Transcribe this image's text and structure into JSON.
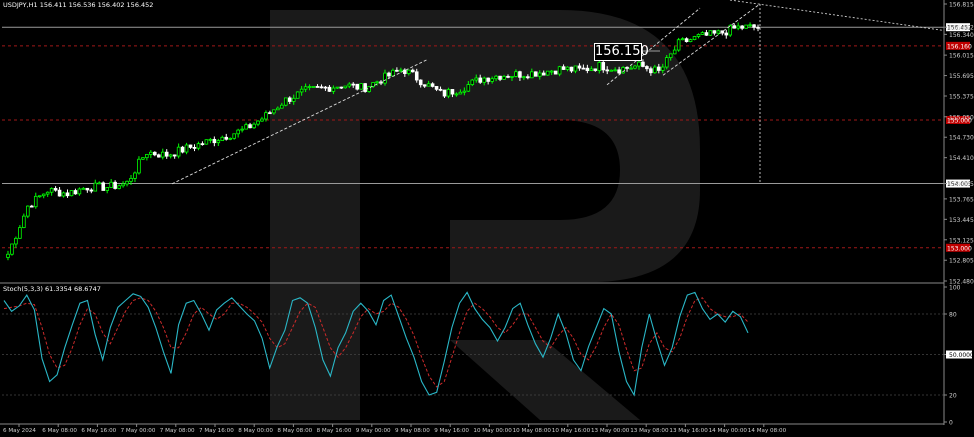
{
  "header": {
    "symbol_line": "USDJPY,H1  156.411 156.536 156.402 156.452",
    "stoch_line": "Stoch(5,3,3) 61.3354 68.6747"
  },
  "callout": {
    "value": "156.150"
  },
  "price_axis": {
    "ticks": [
      "156.815",
      "156.452",
      "156.340",
      "156.015",
      "155.695",
      "155.375",
      "155.050",
      "154.730",
      "154.410",
      "154.005",
      "153.765",
      "153.445",
      "153.125",
      "152.805",
      "152.480"
    ],
    "red_labels": [
      "156.160",
      "155.000",
      "153.000"
    ],
    "white_labels": [
      "156.452",
      "154.005"
    ]
  },
  "stoch_axis": {
    "ticks": [
      "100",
      "80",
      "50.0000",
      "20",
      "0"
    ]
  },
  "time_axis": {
    "ticks": [
      "6 May 2024",
      "6 May 08:00",
      "6 May 16:00",
      "7 May 00:00",
      "7 May 08:00",
      "7 May 16:00",
      "8 May 00:00",
      "8 May 08:00",
      "8 May 16:00",
      "9 May 00:00",
      "9 May 08:00",
      "9 May 16:00",
      "10 May 00:00",
      "10 May 08:00",
      "10 May 16:00",
      "13 May 00:00",
      "13 May 08:00",
      "13 May 16:00",
      "14 May 00:00",
      "14 May 08:00"
    ]
  },
  "colors": {
    "bull": "#00ff00",
    "bear": "#ffffff",
    "stoch_main": "#2ab7c7",
    "stoch_signal": "#cc2a2a",
    "red_level": "#a01818",
    "grid_text": "#cfcfcf"
  },
  "chart_data": [
    {
      "type": "candlestick",
      "title": "USDJPY,H1",
      "ylim": [
        152.48,
        156.815
      ],
      "levels": {
        "current": 156.452,
        "red_dashed": [
          156.16,
          155.0,
          153.0
        ],
        "white_solid": [
          156.452,
          154.005
        ]
      },
      "close_path": [
        {
          "t": "6 May 2024",
          "v": 152.9
        },
        {
          "t": "6 May 04:00",
          "v": 153.65
        },
        {
          "t": "6 May 08:00",
          "v": 153.9
        },
        {
          "t": "6 May 12:00",
          "v": 153.85
        },
        {
          "t": "6 May 16:00",
          "v": 153.95
        },
        {
          "t": "6 May 20:00",
          "v": 153.95
        },
        {
          "t": "7 May 00:00",
          "v": 154.0
        },
        {
          "t": "7 May 04:00",
          "v": 154.5
        },
        {
          "t": "7 May 08:00",
          "v": 154.45
        },
        {
          "t": "7 May 12:00",
          "v": 154.55
        },
        {
          "t": "7 May 16:00",
          "v": 154.65
        },
        {
          "t": "7 May 20:00",
          "v": 154.75
        },
        {
          "t": "8 May 00:00",
          "v": 154.85
        },
        {
          "t": "8 May 04:00",
          "v": 155.05
        },
        {
          "t": "8 May 08:00",
          "v": 155.3
        },
        {
          "t": "8 May 12:00",
          "v": 155.45
        },
        {
          "t": "8 May 16:00",
          "v": 155.5
        },
        {
          "t": "8 May 20:00",
          "v": 155.55
        },
        {
          "t": "9 May 00:00",
          "v": 155.5
        },
        {
          "t": "9 May 04:00",
          "v": 155.65
        },
        {
          "t": "9 May 08:00",
          "v": 155.8
        },
        {
          "t": "9 May 12:00",
          "v": 155.6
        },
        {
          "t": "9 May 16:00",
          "v": 155.4
        },
        {
          "t": "9 May 20:00",
          "v": 155.5
        },
        {
          "t": "10 May 00:00",
          "v": 155.65
        },
        {
          "t": "10 May 04:00",
          "v": 155.7
        },
        {
          "t": "10 May 08:00",
          "v": 155.72
        },
        {
          "t": "10 May 12:00",
          "v": 155.75
        },
        {
          "t": "10 May 16:00",
          "v": 155.8
        },
        {
          "t": "10 May 20:00",
          "v": 155.78
        },
        {
          "t": "13 May 00:00",
          "v": 155.85
        },
        {
          "t": "13 May 04:00",
          "v": 155.8
        },
        {
          "t": "13 May 08:00",
          "v": 155.85
        },
        {
          "t": "13 May 12:00",
          "v": 155.75
        },
        {
          "t": "13 May 16:00",
          "v": 156.2
        },
        {
          "t": "13 May 20:00",
          "v": 156.3
        },
        {
          "t": "14 May 00:00",
          "v": 156.35
        },
        {
          "t": "14 May 04:00",
          "v": 156.45
        },
        {
          "t": "14 May 08:00",
          "v": 156.45
        }
      ]
    },
    {
      "type": "line",
      "title": "Stoch(5,3,3)",
      "ylim": [
        0,
        100
      ],
      "levels": [
        80,
        50,
        20
      ],
      "series": [
        {
          "name": "main",
          "values": [
            90,
            82,
            86,
            94,
            83,
            47,
            30,
            35,
            55,
            72,
            88,
            90,
            65,
            46,
            70,
            85,
            90,
            95,
            93,
            85,
            70,
            52,
            36,
            72,
            88,
            90,
            80,
            68,
            83,
            88,
            92,
            86,
            80,
            75,
            62,
            40,
            56,
            68,
            90,
            92,
            88,
            70,
            46,
            34,
            55,
            66,
            82,
            88,
            82,
            72,
            90,
            94,
            78,
            62,
            48,
            30,
            20,
            22,
            45,
            70,
            88,
            96,
            84,
            76,
            70,
            60,
            70,
            84,
            88,
            72,
            58,
            48,
            62,
            80,
            66,
            46,
            38,
            56,
            70,
            84,
            80,
            52,
            30,
            20,
            55,
            80,
            60,
            42,
            55,
            78,
            94,
            96,
            84,
            76,
            80,
            74,
            82,
            78,
            66
          ]
        },
        {
          "name": "signal",
          "values": [
            84,
            85,
            86,
            88,
            87,
            70,
            50,
            40,
            42,
            55,
            72,
            84,
            80,
            66,
            58,
            70,
            82,
            90,
            92,
            90,
            82,
            70,
            55,
            55,
            66,
            80,
            85,
            80,
            76,
            80,
            88,
            88,
            85,
            80,
            74,
            62,
            55,
            58,
            70,
            82,
            88,
            85,
            70,
            55,
            48,
            55,
            66,
            78,
            84,
            80,
            82,
            88,
            85,
            76,
            64,
            48,
            34,
            26,
            30,
            48,
            66,
            82,
            88,
            84,
            78,
            70,
            66,
            72,
            80,
            80,
            70,
            60,
            55,
            64,
            70,
            62,
            50,
            46,
            56,
            70,
            80,
            72,
            54,
            38,
            40,
            58,
            66,
            55,
            52,
            62,
            78,
            90,
            92,
            84,
            80,
            78,
            78,
            80,
            74
          ]
        }
      ]
    }
  ]
}
